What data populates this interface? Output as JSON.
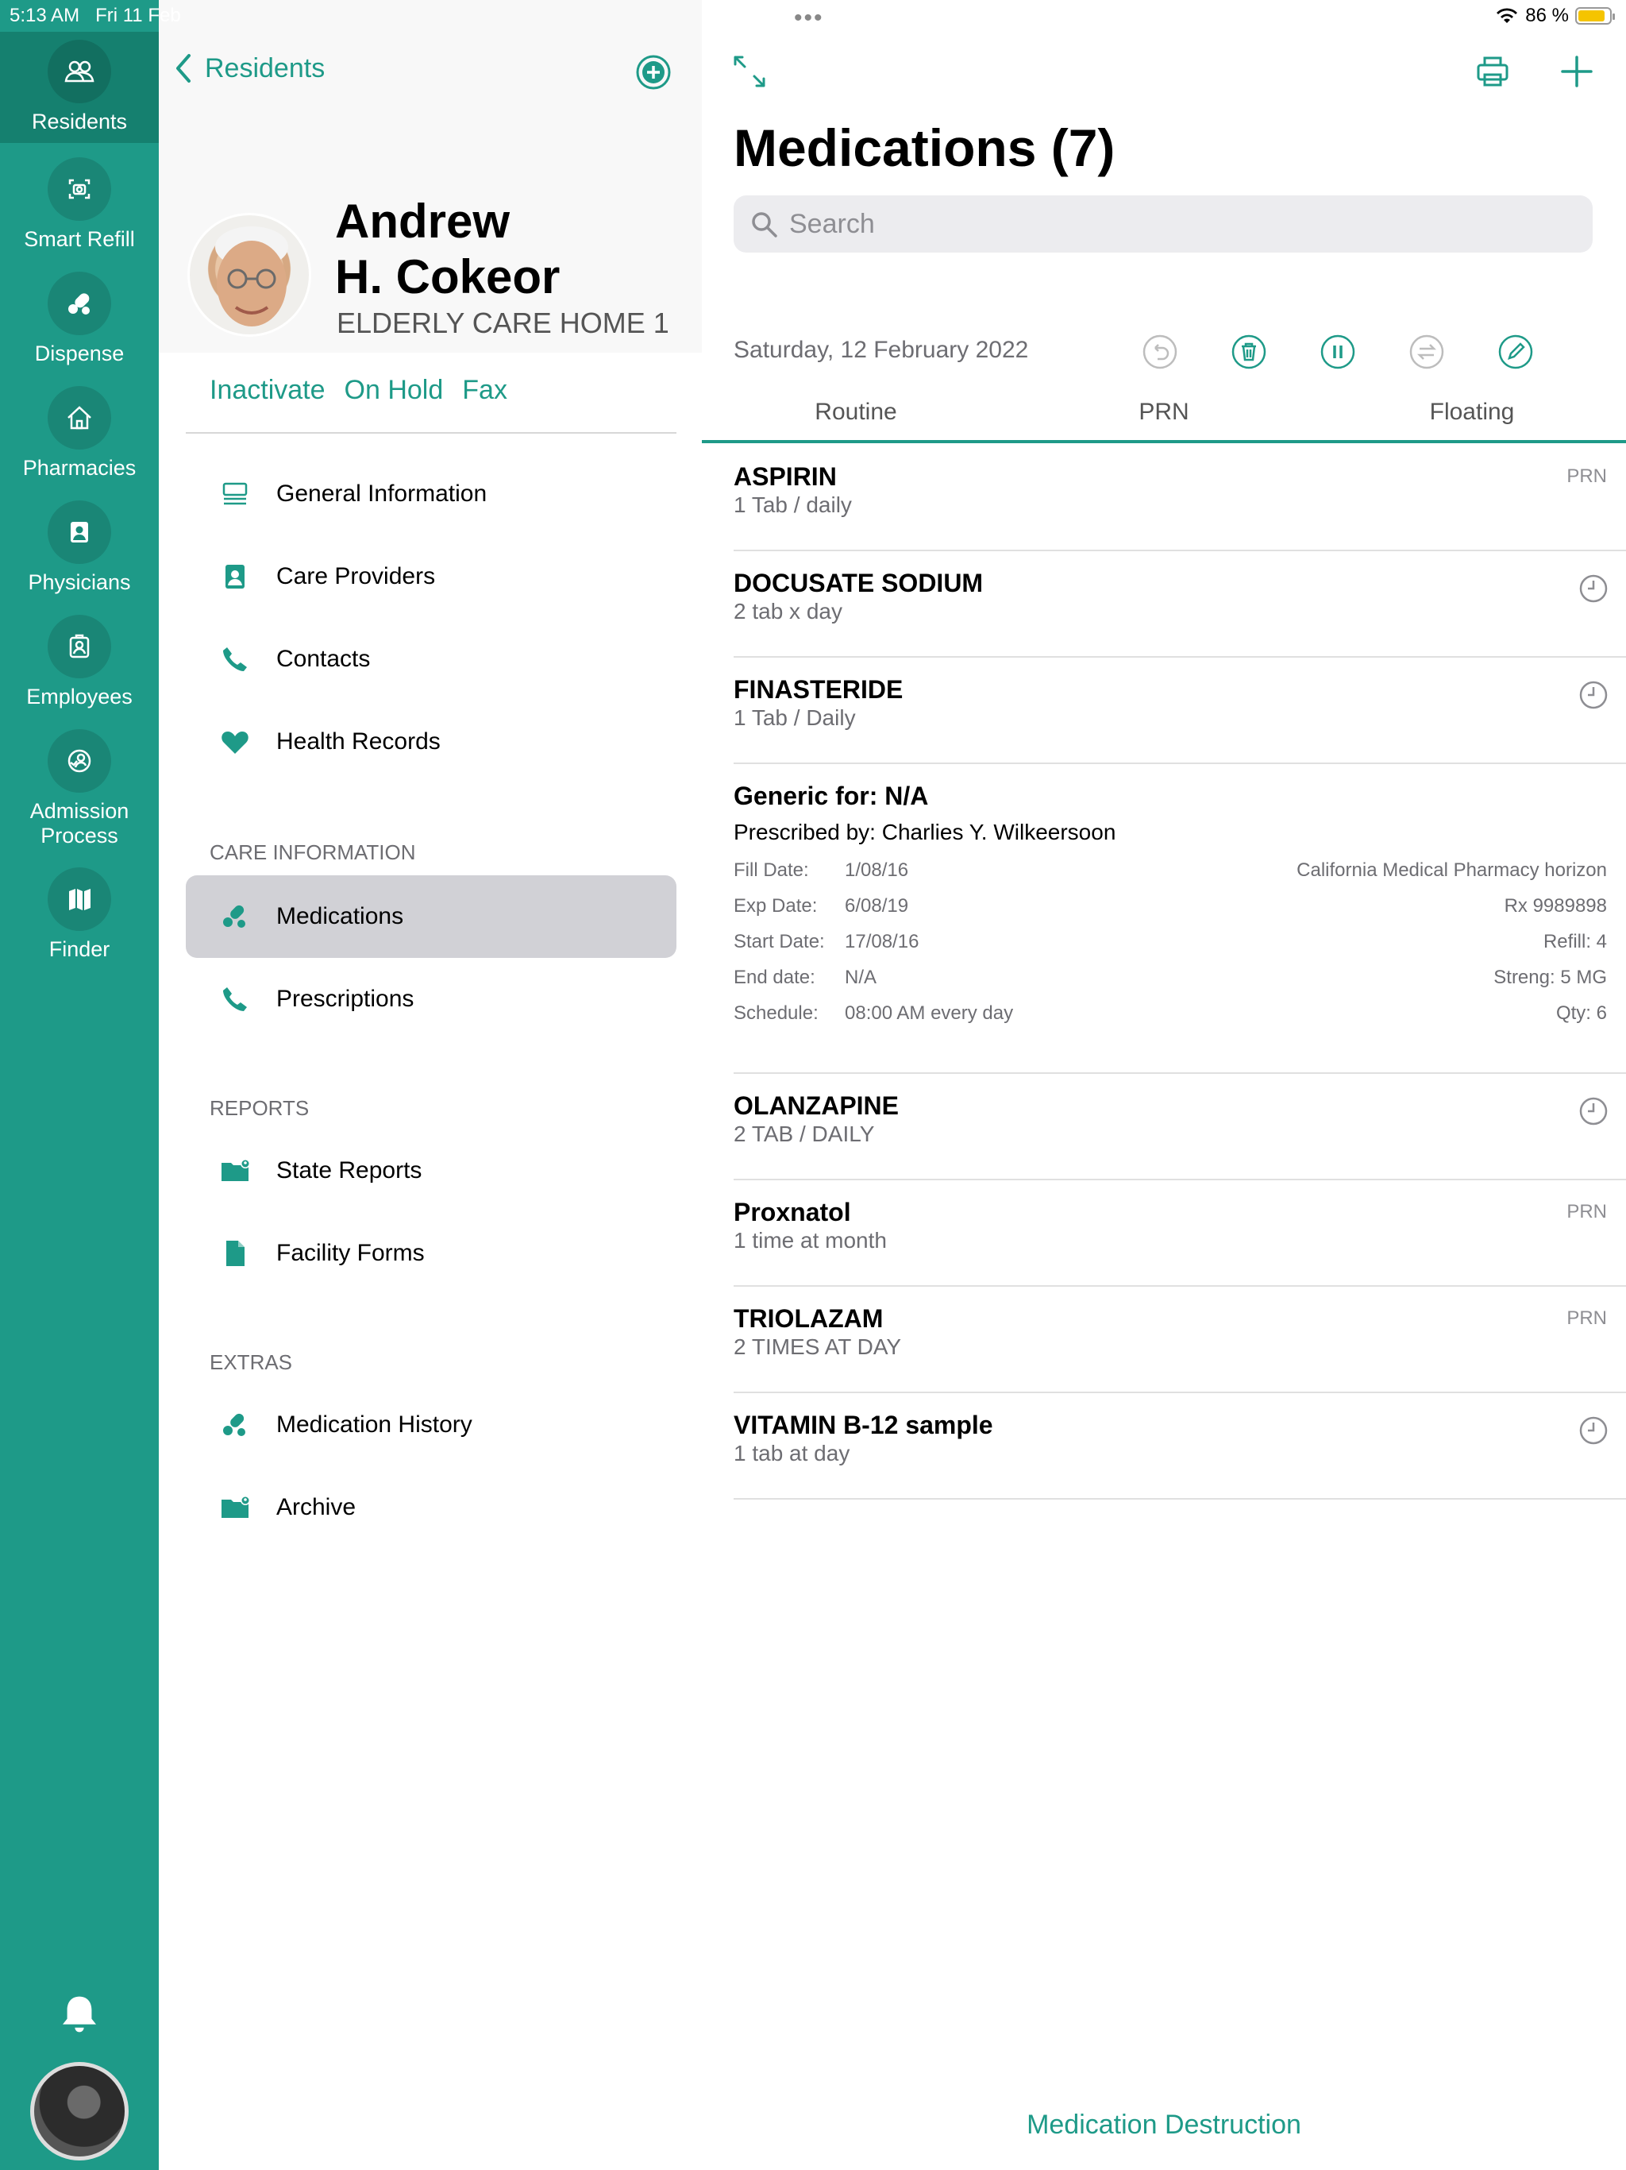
{
  "status_bar": {
    "time": "5:13 AM",
    "date": "Fri 11 Feb",
    "battery": "86 %",
    "battery_level": 0.86
  },
  "colors": {
    "accent": "#1e9a88",
    "rail": "#1e9a88",
    "battery": "#f5c400"
  },
  "rail": {
    "items": [
      {
        "label": "Residents",
        "icon": "people-icon"
      },
      {
        "label": "Smart Refill",
        "icon": "camera-icon"
      },
      {
        "label": "Dispense",
        "icon": "pills-icon"
      },
      {
        "label": "Pharmacies",
        "icon": "house-icon"
      },
      {
        "label": "Physicians",
        "icon": "person-badge-icon"
      },
      {
        "label": "Employees",
        "icon": "employee-badge-icon"
      },
      {
        "label": "Admission Process",
        "icon": "admission-icon"
      },
      {
        "label": "Finder",
        "icon": "map-icon"
      }
    ]
  },
  "residents_panel": {
    "back_label": "Residents",
    "resident": {
      "first_name": "Andrew",
      "last_name": "H. Cokeor",
      "facility": "ELDERLY CARE HOME 1"
    },
    "actions": [
      "Inactivate",
      "On Hold",
      "Fax"
    ],
    "general": [
      "General Information",
      "Care Providers",
      "Contacts",
      "Health Records"
    ],
    "care_header": "CARE INFORMATION",
    "care": [
      "Medications",
      "Prescriptions"
    ],
    "reports_header": "REPORTS",
    "reports": [
      "State Reports",
      "Facility Forms"
    ],
    "extras_header": "EXTRAS",
    "extras": [
      "Medication History",
      "Archive"
    ]
  },
  "medications": {
    "title": "Medications (7)",
    "search_placeholder": "Search",
    "date": "Saturday, 12 February 2022",
    "tabs": [
      "Routine",
      "PRN",
      "Floating"
    ],
    "list": [
      {
        "name": "ASPIRIN",
        "dose": "1 Tab / daily",
        "flag": "PRN"
      },
      {
        "name": "DOCUSATE SODIUM",
        "dose": "2 tab x day",
        "flag": "clock"
      },
      {
        "name": "FINASTERIDE",
        "dose": "1 Tab / Daily",
        "flag": "clock"
      },
      {
        "name": "OLANZAPINE",
        "dose": "2 TAB / DAILY",
        "flag": "clock"
      },
      {
        "name": "Proxnatol",
        "dose": "1 time at month",
        "flag": "PRN"
      },
      {
        "name": "TRIOLAZAM",
        "dose": "2 TIMES AT DAY",
        "flag": "PRN"
      },
      {
        "name": "VITAMIN B-12 sample",
        "dose": "1 tab at day",
        "flag": "clock"
      }
    ],
    "detail": {
      "generic": "Generic for: N/A",
      "prescribed": "Prescribed by: Charlies Y. Wilkeersoon",
      "fill_label": "Fill Date:",
      "fill": "1/08/16",
      "exp_label": "Exp Date:",
      "exp": "6/08/19",
      "start_label": "Start Date:",
      "start": "17/08/16",
      "end_label": "End date:",
      "end": "N/A",
      "schedule_label": "Schedule:",
      "schedule": "08:00 AM every day",
      "pharmacy": "California Medical  Pharmacy horizon",
      "rx": "Rx 9989898",
      "refill": "Refill: 4",
      "strength": "Streng: 5 MG",
      "qty": "Qty: 6"
    },
    "footer": "Medication Destruction"
  }
}
